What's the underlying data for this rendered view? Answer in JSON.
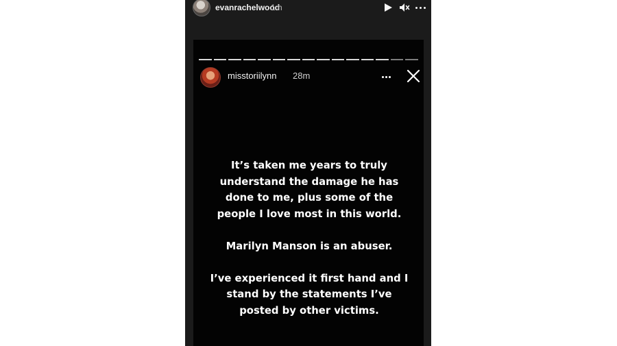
{
  "outer_story": {
    "username": "evanrachelwood",
    "time": "1 h",
    "icons": [
      "play-icon",
      "mute-icon",
      "more-options-icon"
    ]
  },
  "inner_story": {
    "username": "misstoriilynn",
    "time": "28m",
    "progress_segments": 15,
    "icons": [
      "more-options-icon",
      "close-icon"
    ],
    "text": {
      "paragraph1": "It’s taken me years to truly understand the damage he has done to me, plus some of the people I love most in this world.",
      "paragraph2": "Marilyn Manson is an abuser.",
      "paragraph3": "I’ve experienced it first hand and I stand by the statements I’ve posted by other victims."
    }
  },
  "colors": {
    "outer_panel_background": "#1b1b1b",
    "inner_story_background": "#030303",
    "text": "#ffffff"
  }
}
